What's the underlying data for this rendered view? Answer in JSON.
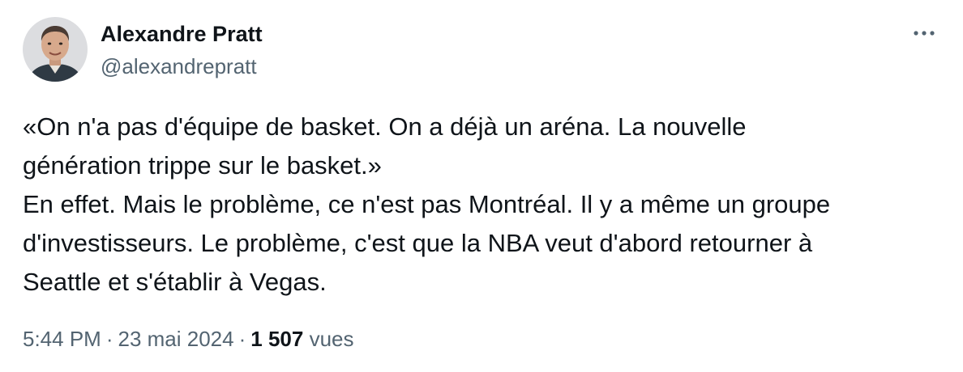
{
  "author": {
    "display_name": "Alexandre Pratt",
    "handle": "@alexandrepratt"
  },
  "more_icon": "more-horizontal-icon",
  "tweet": {
    "lines": [
      "«On n'a pas d'équipe de basket. On a déjà un aréna. La nouvelle",
      "génération trippe sur le basket.»",
      "En effet. Mais le problème, ce n'est pas Montréal. Il y a même un groupe",
      "d'investisseurs. Le problème, c'est que la NBA veut d'abord retourner à",
      "Seattle et s'établir à Vegas."
    ]
  },
  "meta": {
    "time": "5:44 PM",
    "separator": "·",
    "date": "23 mai 2024",
    "views_count": "1 507",
    "views_label": "vues"
  },
  "colors": {
    "text_primary": "#0f1419",
    "text_secondary": "#536471"
  }
}
